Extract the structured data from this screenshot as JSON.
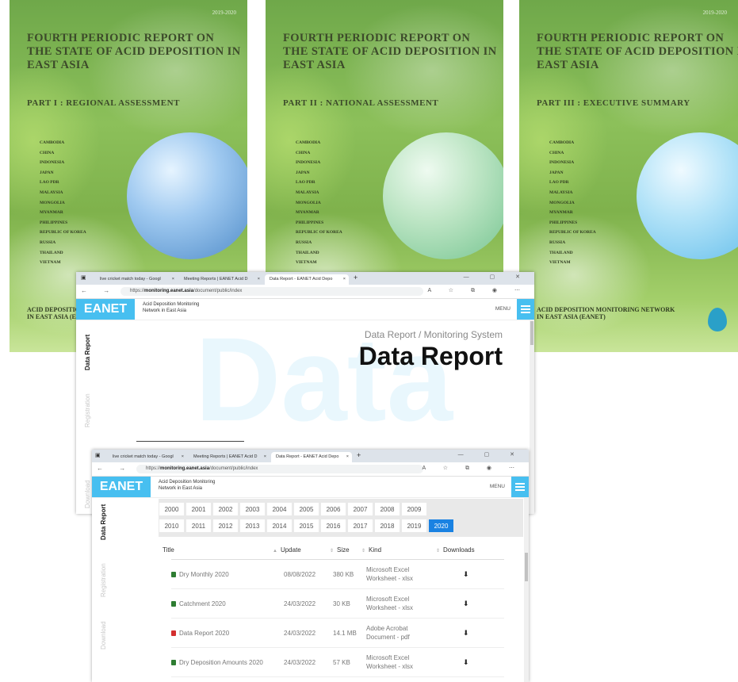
{
  "covers": [
    {
      "year": "2019-2020",
      "title": "Fourth Periodic Report on the State of Acid Deposition in East Asia",
      "part": "Part I : Regional Assessment",
      "footer_lines": [
        "Acid Deposition Monitoring Network",
        "in East Asia (EANET)"
      ]
    },
    {
      "year": "",
      "title": "Fourth Periodic Report on the State of Acid Deposition in East Asia",
      "part": "Part II : National Assessment",
      "footer_lines": [
        "",
        ""
      ]
    },
    {
      "year": "2019-2020",
      "title": "Fourth Periodic Report on the State of Acid Deposition in East Asia",
      "part": "Part III : Executive Summary",
      "footer_lines": [
        "Acid Deposition Monitoring Network",
        "in East Asia (EANET)"
      ]
    }
  ],
  "countries": [
    "Cambodia",
    "China",
    "Indonesia",
    "Japan",
    "Lao PDR",
    "Malaysia",
    "Mongolia",
    "Myanmar",
    "Philippines",
    "Republic of Korea",
    "Russia",
    "Thailand",
    "Vietnam"
  ],
  "browser": {
    "tabs": [
      "live cricket match today - Googl",
      "Meeting Reports | EANET Acid D",
      "Data Report - EANET Acid Depo"
    ],
    "tab_close": "×",
    "new_tab": "+",
    "url_prefix": "https://",
    "url_host": "monitoring.eanet.asia",
    "url_path": "/document/public/index",
    "controls": "—  ▢  ✕"
  },
  "site": {
    "logo": "EANET",
    "name_line1": "Acid Deposition Monitoring",
    "name_line2": "Network in East Asia",
    "menu": "MENU"
  },
  "sidebar": {
    "data_report": "Data Report",
    "registration": "Registration",
    "download": "Download"
  },
  "hero": {
    "breadcrumb": "Data Report / Monitoring System",
    "title": "Data Report",
    "bg_word": "Data"
  },
  "years": [
    "2000",
    "2001",
    "2002",
    "2003",
    "2004",
    "2005",
    "2006",
    "2007",
    "2008",
    "2009",
    "2010",
    "2011",
    "2012",
    "2013",
    "2014",
    "2015",
    "2016",
    "2017",
    "2018",
    "2019",
    "2020"
  ],
  "selected_year": "2020",
  "table": {
    "headers": {
      "title": "Title",
      "update": "Update",
      "size": "Size",
      "kind": "Kind",
      "downloads": "Downloads"
    },
    "rows": [
      {
        "title": "Dry Monthly 2020",
        "update": "08/08/2022",
        "size": "380 KB",
        "kind1": "Microsoft Excel",
        "kind2": "Worksheet - xlsx",
        "icon": "excel-icon"
      },
      {
        "title": "Catchment 2020",
        "update": "24/03/2022",
        "size": "30 KB",
        "kind1": "Microsoft Excel",
        "kind2": "Worksheet - xlsx",
        "icon": "excel-icon"
      },
      {
        "title": "Data Report 2020",
        "update": "24/03/2022",
        "size": "14.1 MB",
        "kind1": "Adobe Acrobat",
        "kind2": "Document - pdf",
        "icon": "pdf-icon"
      },
      {
        "title": "Dry Deposition Amounts 2020",
        "update": "24/03/2022",
        "size": "57 KB",
        "kind1": "Microsoft Excel",
        "kind2": "Worksheet - xlsx",
        "icon": "excel-icon"
      }
    ]
  },
  "colors": {
    "accent": "#47bff0",
    "active_year": "#1a82e2",
    "excel": "#2e7d32",
    "pdf": "#d32f2f"
  }
}
